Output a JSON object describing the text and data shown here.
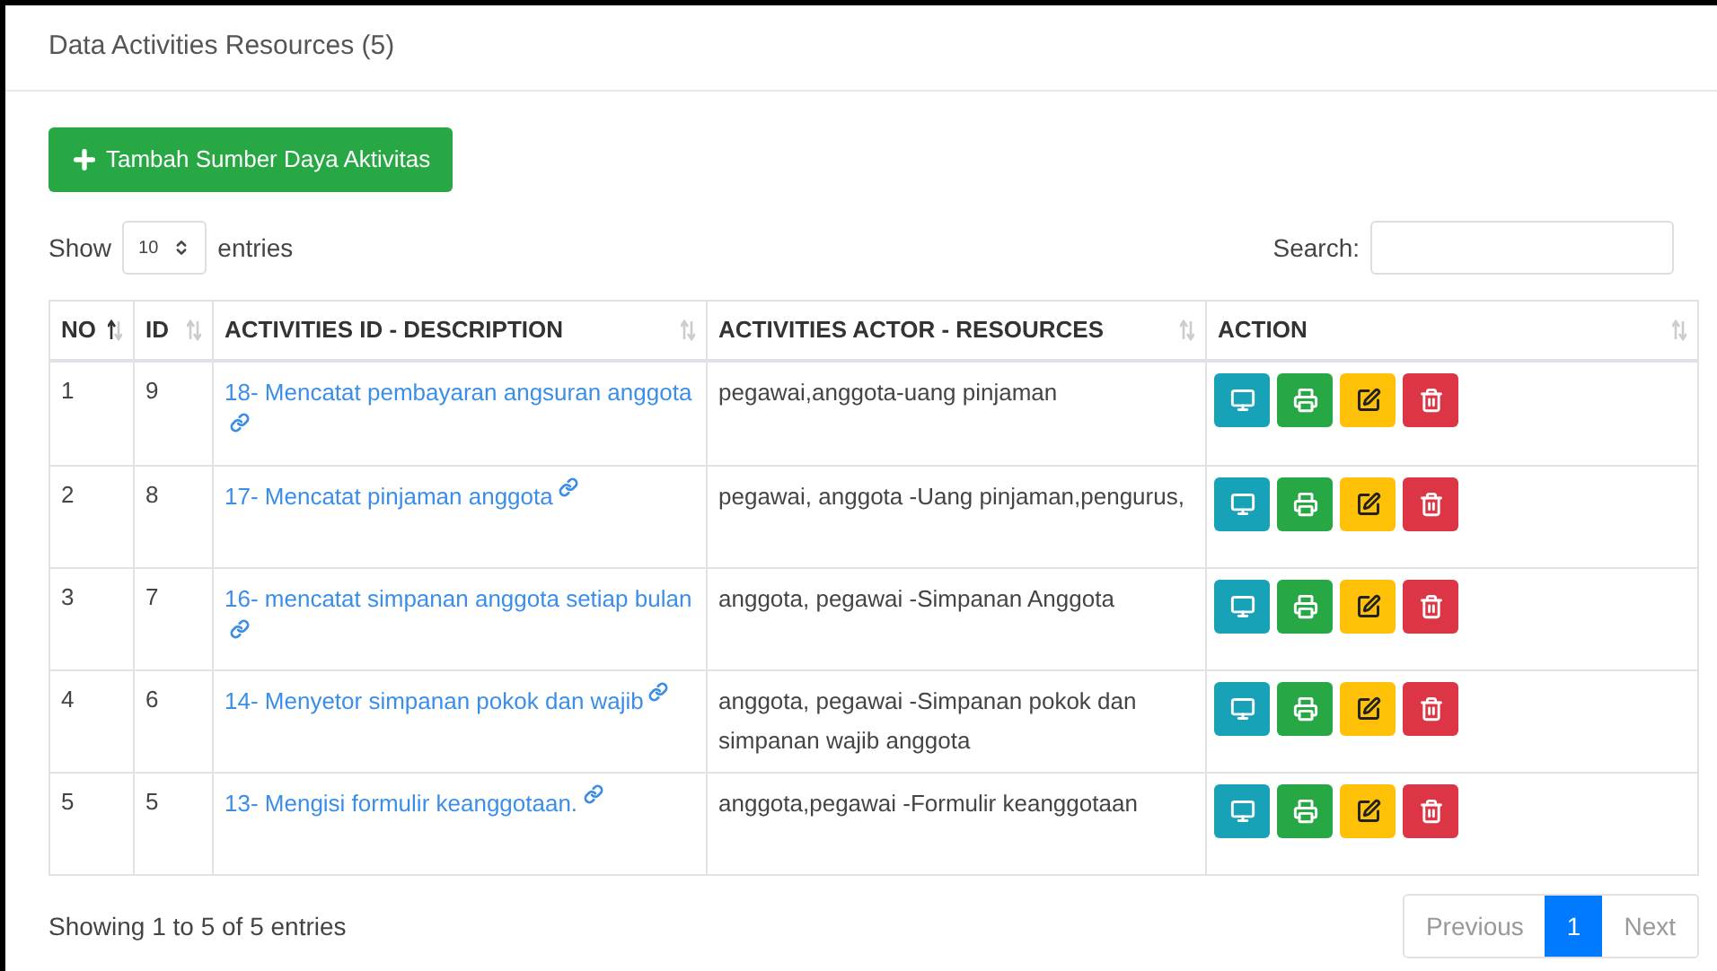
{
  "card": {
    "title": "Data Activities Resources (5)"
  },
  "add_button": {
    "label": "Tambah Sumber Daya Aktivitas"
  },
  "length": {
    "prefix": "Show",
    "value": "10",
    "suffix": "entries"
  },
  "search": {
    "label": "Search:"
  },
  "table": {
    "columns": [
      {
        "label": "NO",
        "sorted": true
      },
      {
        "label": "ID",
        "sorted": false
      },
      {
        "label": "ACTIVITIES ID - DESCRIPTION",
        "sorted": false
      },
      {
        "label": "ACTIVITIES ACTOR - RESOURCES",
        "sorted": false
      },
      {
        "label": "ACTION",
        "sorted": false
      }
    ],
    "rows": [
      {
        "no": "1",
        "id": "9",
        "description": "18- Mencatat pembayaran angsuran anggota",
        "actor_resources": "pegawai,anggota-uang pinjaman"
      },
      {
        "no": "2",
        "id": "8",
        "description": "17- Mencatat pinjaman anggota",
        "actor_resources": "pegawai, anggota -Uang pinjaman,pengurus,"
      },
      {
        "no": "3",
        "id": "7",
        "description": "16- mencatat simpanan anggota setiap bulan",
        "actor_resources": "anggota, pegawai -Simpanan Anggota"
      },
      {
        "no": "4",
        "id": "6",
        "description": "14- Menyetor simpanan pokok dan wajib",
        "actor_resources": "anggota, pegawai -Simpanan pokok dan simpanan wajib anggota"
      },
      {
        "no": "5",
        "id": "5",
        "description": "13- Mengisi formulir keanggotaan.",
        "actor_resources": "anggota,pegawai -Formulir keanggotaan"
      }
    ]
  },
  "info": "Showing 1 to 5 of 5 entries",
  "pagination": [
    {
      "label": "Previous",
      "selected": false
    },
    {
      "label": "1",
      "selected": true
    },
    {
      "label": "Next",
      "selected": false
    }
  ]
}
